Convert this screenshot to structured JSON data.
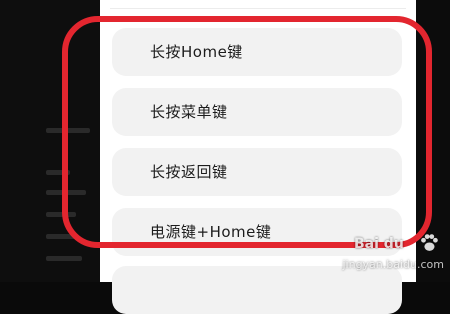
{
  "options": [
    {
      "label": "长按Home键"
    },
    {
      "label": "长按菜单键"
    },
    {
      "label": "长按返回键"
    },
    {
      "label": "电源键+Home键"
    }
  ],
  "annotation": {
    "color": "#e3262f"
  },
  "watermark": {
    "brand": "Bai du",
    "url": "jingyan.baidu.com",
    "icon": "paw-icon"
  }
}
